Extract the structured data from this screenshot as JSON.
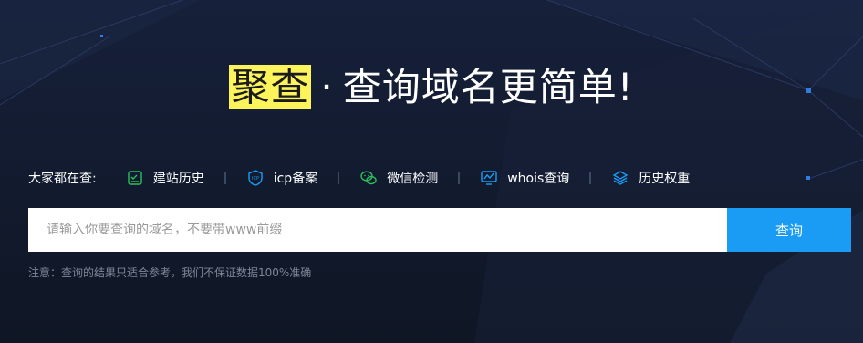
{
  "hero": {
    "brand": "聚查",
    "separator": "·",
    "tagline": "查询域名更简单!"
  },
  "quick_links": {
    "label": "大家都在查:",
    "items": [
      {
        "label": "建站历史",
        "icon": "site-history-icon",
        "color": "#2bbf5b"
      },
      {
        "label": "icp备案",
        "icon": "shield-icon",
        "color": "#1a9cf5"
      },
      {
        "label": "微信检测",
        "icon": "wechat-icon",
        "color": "#2bbf5b"
      },
      {
        "label": "whois查询",
        "icon": "monitor-chart-icon",
        "color": "#1a9cf5"
      },
      {
        "label": "历史权重",
        "icon": "stack-layers-icon",
        "color": "#1a9cf5"
      }
    ]
  },
  "search": {
    "placeholder": "请输入你要查询的域名，不要带www前缀",
    "button_label": "查询"
  },
  "note": "注意：查询的结果只适合参考，我们不保证数据100%准确",
  "colors": {
    "background": "#121a2a",
    "highlight": "#fdf35b",
    "accent_blue": "#1a9cf5",
    "accent_green": "#2bbf5b"
  }
}
